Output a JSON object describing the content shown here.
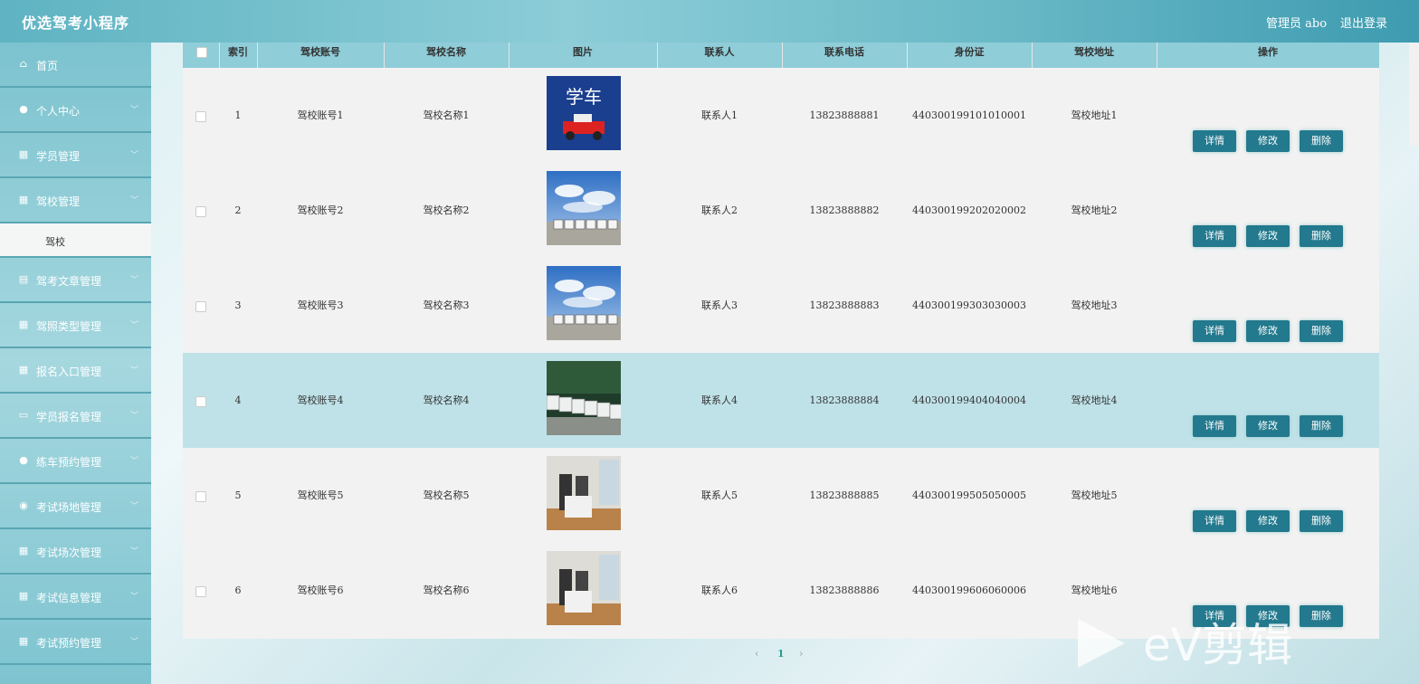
{
  "header": {
    "app_title": "优选驾考小程序",
    "admin_label": "管理员 abo",
    "logout_label": "退出登录"
  },
  "sidebar": {
    "items": [
      {
        "label": "首页",
        "icon": "home-icon"
      },
      {
        "label": "个人中心",
        "icon": "user-icon"
      },
      {
        "label": "学员管理",
        "icon": "grid-icon"
      },
      {
        "label": "驾校管理",
        "icon": "grid-icon"
      },
      {
        "label": "驾考文章管理",
        "icon": "clipboard-icon"
      },
      {
        "label": "驾照类型管理",
        "icon": "grid-icon"
      },
      {
        "label": "报名入口管理",
        "icon": "grid-icon"
      },
      {
        "label": "学员报名管理",
        "icon": "briefcase-icon"
      },
      {
        "label": "练车预约管理",
        "icon": "user-icon"
      },
      {
        "label": "考试场地管理",
        "icon": "location-icon"
      },
      {
        "label": "考试场次管理",
        "icon": "grid-icon"
      },
      {
        "label": "考试信息管理",
        "icon": "grid-icon"
      },
      {
        "label": "考试预约管理",
        "icon": "grid-icon"
      }
    ],
    "sub_item": "驾校"
  },
  "table": {
    "headers": [
      "索引",
      "驾校账号",
      "驾校名称",
      "图片",
      "联系人",
      "联系电话",
      "身份证",
      "驾校地址",
      "操作"
    ],
    "rows": [
      {
        "index": "1",
        "account": "驾校账号1",
        "name": "驾校名称1",
        "image": "xueche-logo",
        "contact": "联系人1",
        "phone": "13823888881",
        "id_card": "440300199101010001",
        "address": "驾校地址1",
        "highlight": false
      },
      {
        "index": "2",
        "account": "驾校账号2",
        "name": "驾校名称2",
        "image": "cars-sky",
        "contact": "联系人2",
        "phone": "13823888882",
        "id_card": "440300199202020002",
        "address": "驾校地址2",
        "highlight": false
      },
      {
        "index": "3",
        "account": "驾校账号3",
        "name": "驾校名称3",
        "image": "cars-sky",
        "contact": "联系人3",
        "phone": "13823888883",
        "id_card": "440300199303030003",
        "address": "驾校地址3",
        "highlight": false
      },
      {
        "index": "4",
        "account": "驾校账号4",
        "name": "驾校名称4",
        "image": "cars-row",
        "contact": "联系人4",
        "phone": "13823888884",
        "id_card": "440300199404040004",
        "address": "驾校地址4",
        "highlight": true
      },
      {
        "index": "5",
        "account": "驾校账号5",
        "name": "驾校名称5",
        "image": "simulator-room",
        "contact": "联系人5",
        "phone": "13823888885",
        "id_card": "440300199505050005",
        "address": "驾校地址5",
        "highlight": false
      },
      {
        "index": "6",
        "account": "驾校账号6",
        "name": "驾校名称6",
        "image": "simulator-room",
        "contact": "联系人6",
        "phone": "13823888886",
        "id_card": "440300199606060006",
        "address": "驾校地址6",
        "highlight": false
      }
    ],
    "actions": [
      "详情",
      "修改",
      "删除"
    ],
    "image_logo_text": "学车"
  },
  "pagination": {
    "prev": "‹",
    "current": "1",
    "next": "›"
  },
  "watermark": "eV剪辑",
  "colors": {
    "button": "#23798d",
    "header": "#8fcdd8",
    "highlight_row": "#bfe2e8"
  }
}
